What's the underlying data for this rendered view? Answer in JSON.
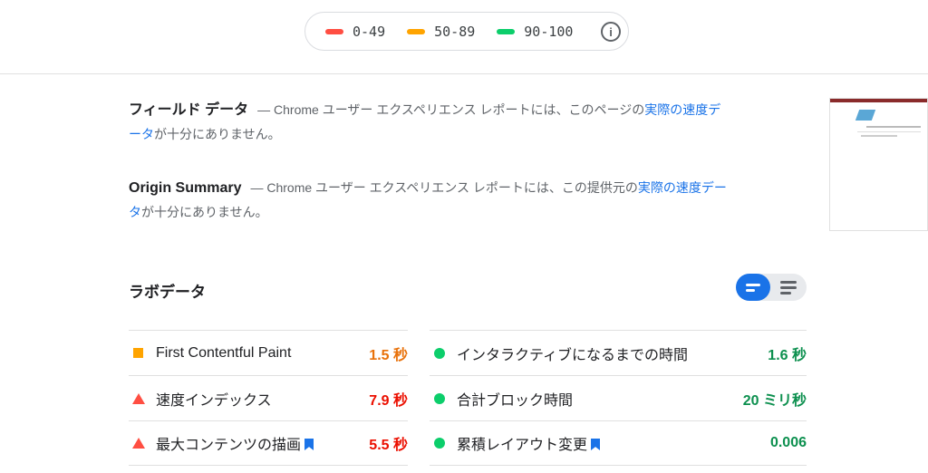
{
  "legend": {
    "items": [
      {
        "range": "0-49",
        "color": "#ff4e42"
      },
      {
        "range": "50-89",
        "color": "#ffa400"
      },
      {
        "range": "90-100",
        "color": "#0cce6b"
      }
    ],
    "info_icon": "info-icon"
  },
  "field_data": {
    "title": "フィールド データ",
    "text": "— Chrome ユーザー エクスペリエンス レポートには、このページの",
    "link": "実際の速度データ",
    "text_end": "が十分にありません。",
    "line1_link_part": "実際の速度デ",
    "line2_link_part": "ータ"
  },
  "origin_summary": {
    "title": "Origin Summary",
    "text": "— Chrome ユーザー エクスペリエンス レポートには、この提供元の",
    "line1_link_part": "実際の速度デー",
    "line2_link_part": "タ",
    "text_end": "が十分にありません。"
  },
  "lab": {
    "title": "ラボデータ",
    "toggle_on_icon": "summary-view-icon",
    "toggle_off_icon": "list-view-icon"
  },
  "metrics_left": [
    {
      "label": "First Contentful Paint",
      "value": "1.5 秒",
      "status": "average",
      "icon": "orange-square-icon"
    },
    {
      "label": "速度インデックス",
      "value": "7.9 秒",
      "status": "fail",
      "icon": "red-triangle-icon"
    },
    {
      "label": "最大コンテンツの描画",
      "value": "5.5 秒",
      "status": "fail",
      "icon": "red-triangle-icon",
      "bookmark": true
    }
  ],
  "metrics_right": [
    {
      "label": "インタラクティブになるまでの時間",
      "value": "1.6 秒",
      "status": "pass",
      "icon": "green-circle-icon"
    },
    {
      "label": "合計ブロック時間",
      "value": "20 ミリ秒",
      "status": "pass",
      "icon": "green-circle-icon"
    },
    {
      "label": "累積レイアウト変更",
      "value": "0.006",
      "status": "pass",
      "icon": "green-circle-icon",
      "bookmark": true
    }
  ],
  "colors": {
    "accent": "#1a73e8",
    "fail": "#ff4e42",
    "average": "#ffa400",
    "pass": "#0cce6b"
  }
}
